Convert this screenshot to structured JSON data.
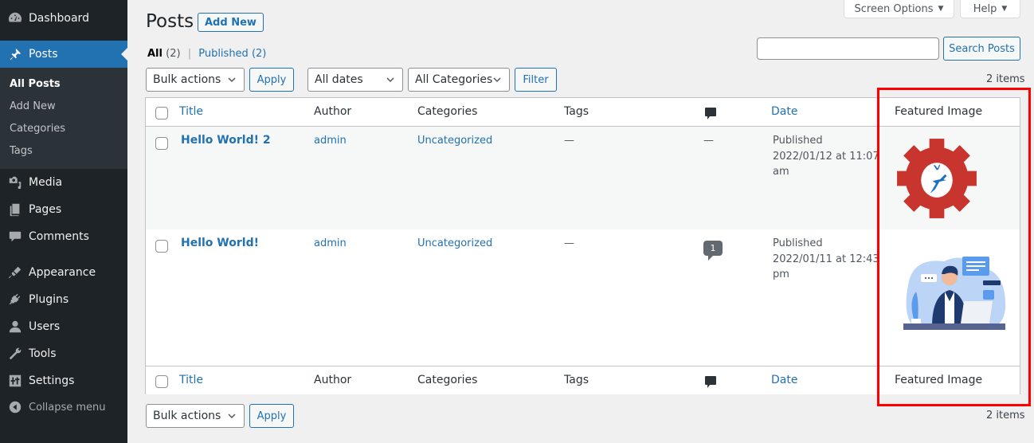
{
  "sidebar": {
    "items": [
      {
        "label": "Dashboard",
        "icon": "dashboard-icon"
      },
      {
        "label": "Posts",
        "icon": "pin-icon",
        "active": true
      },
      {
        "label": "Media",
        "icon": "media-icon"
      },
      {
        "label": "Pages",
        "icon": "pages-icon"
      },
      {
        "label": "Comments",
        "icon": "comments-icon"
      },
      {
        "label": "Appearance",
        "icon": "brush-icon"
      },
      {
        "label": "Plugins",
        "icon": "plugin-icon"
      },
      {
        "label": "Users",
        "icon": "user-icon"
      },
      {
        "label": "Tools",
        "icon": "wrench-icon"
      },
      {
        "label": "Settings",
        "icon": "settings-icon"
      }
    ],
    "submenu": [
      "All Posts",
      "Add New",
      "Categories",
      "Tags"
    ],
    "collapse_label": "Collapse menu"
  },
  "header": {
    "screen_options": "Screen Options",
    "help": "Help",
    "title": "Posts",
    "add_new": "Add New"
  },
  "filters": {
    "all_label": "All",
    "all_count": "(2)",
    "published_label": "Published",
    "published_count": "(2)",
    "separator": "|",
    "search_value": "",
    "search_button": "Search Posts",
    "bulk_actions": "Bulk actions",
    "apply": "Apply",
    "dates": "All dates",
    "categories": "All Categories",
    "filter": "Filter",
    "items_count": "2 items"
  },
  "table": {
    "columns": {
      "title": "Title",
      "author": "Author",
      "categories": "Categories",
      "tags": "Tags",
      "comments_icon": "comment-bubble-icon",
      "date": "Date",
      "featured_image": "Featured Image"
    },
    "rows": [
      {
        "title": "Hello World! 2",
        "author": "admin",
        "categories": "Uncategorized",
        "tags": "—",
        "comments": "—",
        "status": "Published",
        "date_line1": "2022/01/12 at 11:07",
        "date_line2": "am",
        "featured_image": "gear-deer-logo-image"
      },
      {
        "title": "Hello World!",
        "author": "admin",
        "categories": "Uncategorized",
        "tags": "—",
        "comments": "1",
        "status": "Published",
        "date_line1": "2022/01/11 at 12:43",
        "date_line2": "pm",
        "featured_image": "customer-support-illustration-image"
      }
    ]
  },
  "colors": {
    "accent": "#2271b1",
    "sidebar_bg": "#1d2327",
    "highlight": "#ff0000",
    "gear": "#c8352e"
  }
}
